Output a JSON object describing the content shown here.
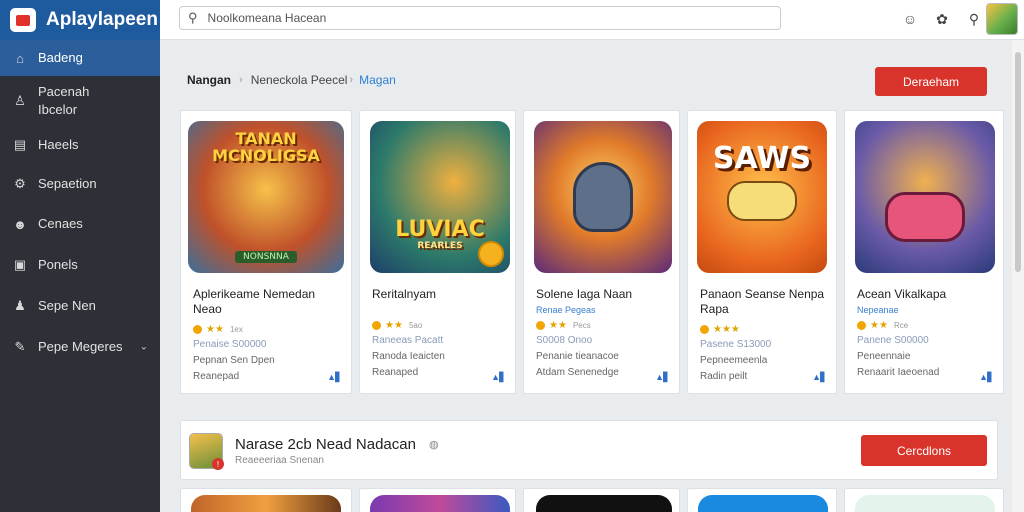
{
  "app": {
    "title": "Aplaylapeen"
  },
  "sidebar": {
    "items": [
      {
        "label": "Badeng",
        "icon": "home-icon"
      },
      {
        "label": "Pacenah\nIbcelor",
        "icon": "user-icon"
      },
      {
        "label": "Haeels",
        "icon": "list-icon"
      },
      {
        "label": "Sepaetion",
        "icon": "settings-icon"
      },
      {
        "label": "Cenaes",
        "icon": "people-icon"
      },
      {
        "label": "Ponels",
        "icon": "panel-icon"
      },
      {
        "label": "Sepe Nen",
        "icon": "person-icon"
      },
      {
        "label": "Pepe Megeres",
        "icon": "wrench-icon"
      }
    ]
  },
  "search": {
    "value": "Noolkomeana Hacean"
  },
  "breadcrumb": {
    "root": "Nangan",
    "middle": "Neneckola Peecel",
    "current": "Magan"
  },
  "header_button": "Deraeham",
  "cards": [
    {
      "art": "TANAN\nMCNOLIGSA",
      "art_bottom": "NONSNNA",
      "title": "Aplerikeame Nemedan\nNeao",
      "subtitle": "",
      "rating": "1ex",
      "meta1": "Penaise S00000",
      "meta2": "Pepnan Sen Dpen",
      "meta3": "Reanepad"
    },
    {
      "art": "LUVIAC",
      "art_bottom": "REARLES",
      "title": "Reritalnyam",
      "subtitle": "",
      "rating": "5ao",
      "meta1": "Raneeas Pacatt",
      "meta2": "Ranoda Ieaicten",
      "meta3": "Reanaped"
    },
    {
      "art": "",
      "art_bottom": "",
      "title": "Solene Iaga Naan",
      "subtitle": "Renae Pegeas",
      "rating": "Pecs",
      "meta1": "S0008 Onoo",
      "meta2": "Penanie tieanacoe",
      "meta3": "Atdam Senenedge"
    },
    {
      "art": "SAWS",
      "art_bottom": "",
      "title": "Panaon Seanse Nenpa\nRapa",
      "subtitle": "",
      "rating": "",
      "meta1": "Pasene S13000",
      "meta2": "Pepneemeenla",
      "meta3": "Radin peilt"
    },
    {
      "art": "",
      "art_bottom": "",
      "title": "Acean Vikalkapa",
      "subtitle": "Nepeanae",
      "rating": "Rce",
      "meta1": "Panene S00000",
      "meta2": "Peneennaie",
      "meta3": "Renaarit Iaeoenad"
    }
  ],
  "section": {
    "title": "Narase 2cb Nead Nadacan",
    "subtitle": "Reaeeeriaa Snenan",
    "button": "Cercdlons"
  },
  "colors": {
    "accent": "#d9342b",
    "brand": "#1e5a9e",
    "sidebar": "#2d3036",
    "link": "#2f80d0"
  }
}
